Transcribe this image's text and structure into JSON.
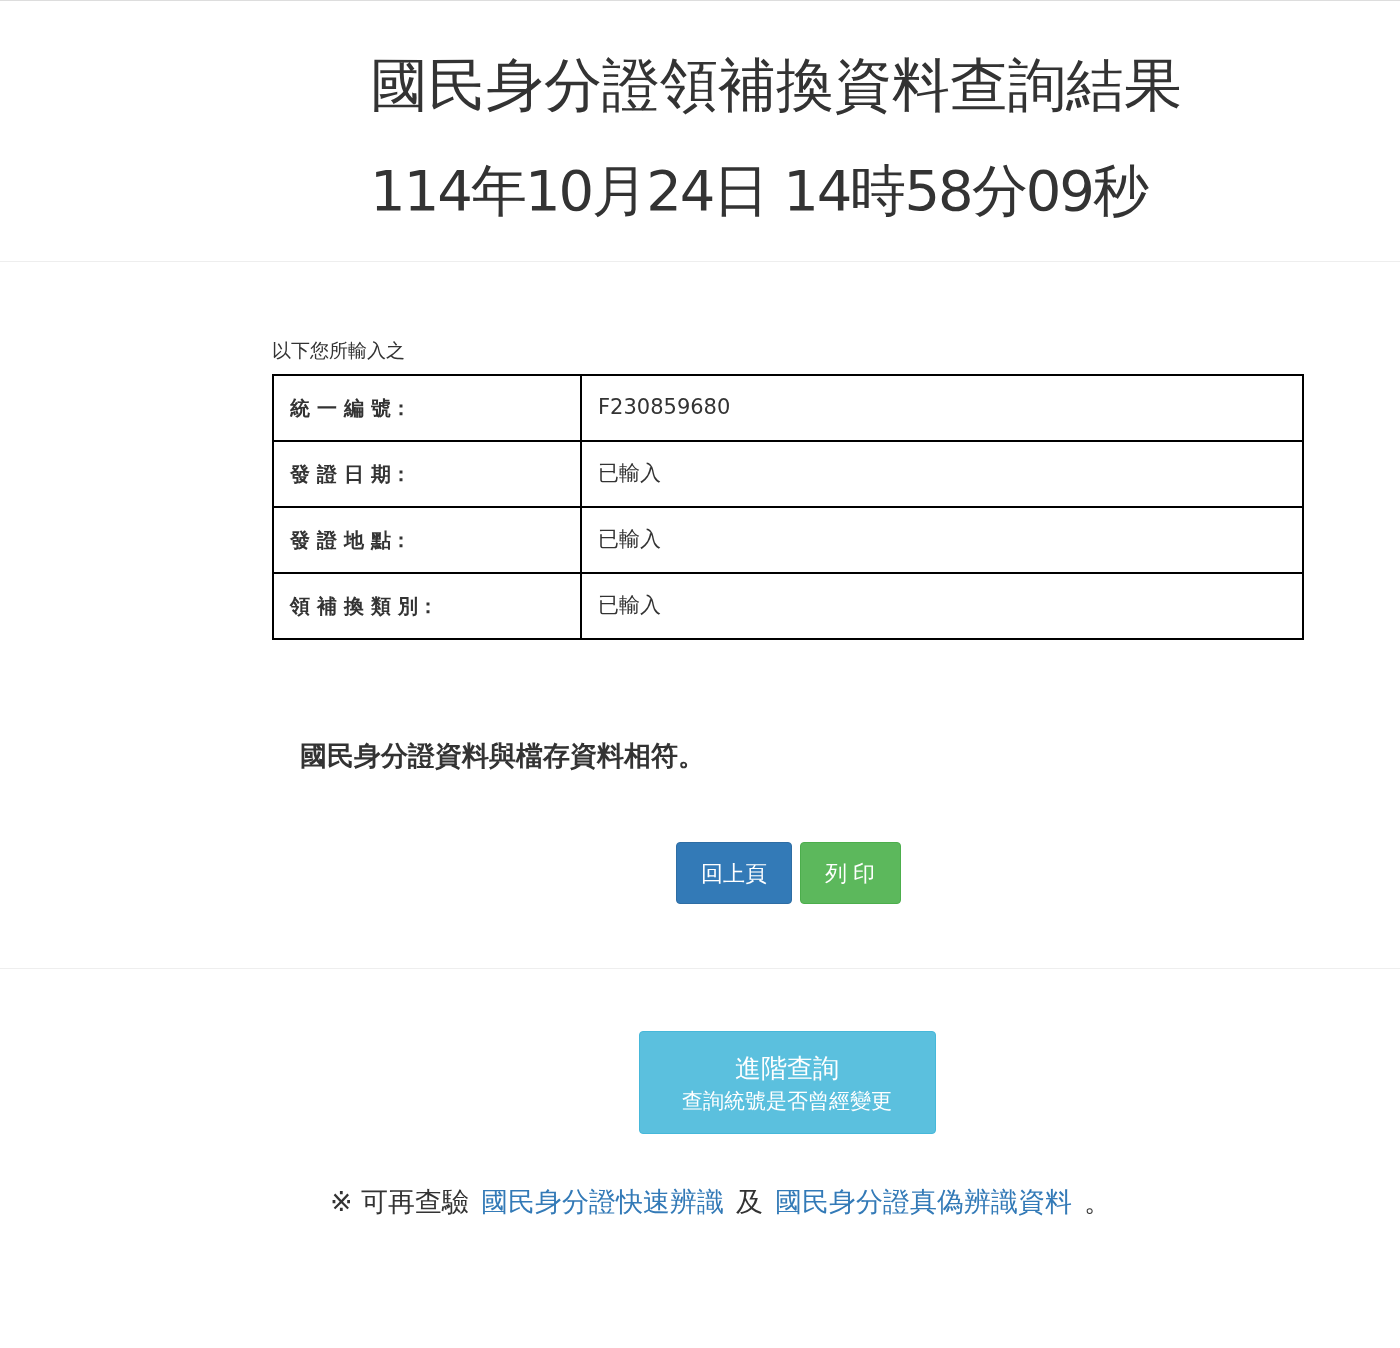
{
  "title": "國民身分證領補換資料查詢結果",
  "timestamp": "114年10月24日 14時58分09秒",
  "input_caption": "以下您所輸入之",
  "table": {
    "rows": [
      {
        "label": "統 一 編 號：",
        "value": "F230859680"
      },
      {
        "label": "發 證 日 期：",
        "value": "已輸入"
      },
      {
        "label": "發 證 地 點：",
        "value": "已輸入"
      },
      {
        "label": "領 補 換 類 別：",
        "value": "已輸入"
      }
    ]
  },
  "result": "國民身分證資料與檔存資料相符。",
  "buttons": [
    {
      "label": "回上頁",
      "kind": "primary"
    },
    {
      "label": "列 印",
      "kind": "success"
    }
  ],
  "advanced_button": {
    "title": "進階查詢",
    "subtitle": "查詢統號是否曾經變更"
  },
  "footer": {
    "prefix": "※ 可再查驗",
    "link_1": "國民身分證快速辨識",
    "middle": "及",
    "link_2": "國民身分證真偽辨識資料",
    "suffix": "。"
  }
}
